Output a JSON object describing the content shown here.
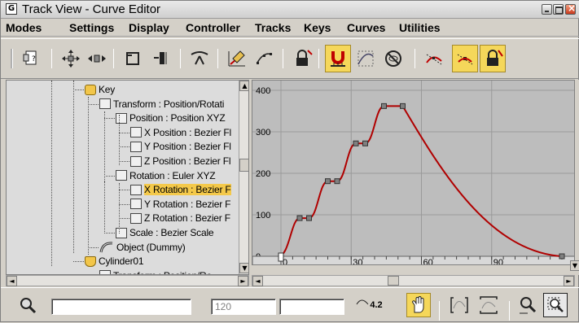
{
  "window": {
    "title": "Track View - Curve Editor",
    "app_icon": "curve-editor-icon"
  },
  "menu": [
    "Modes",
    "Settings",
    "Display",
    "Controller",
    "Tracks",
    "Keys",
    "Curves",
    "Utilities"
  ],
  "toolbar": [
    {
      "name": "filters-icon",
      "active": false
    },
    {
      "name": "move-keys-icon",
      "active": false
    },
    {
      "name": "slide-keys-icon",
      "active": false
    },
    {
      "name": "scale-keys-icon",
      "active": false
    },
    {
      "name": "scale-values-icon",
      "active": false
    },
    {
      "name": "add-keys-icon",
      "active": false
    },
    {
      "name": "draw-curves-icon",
      "active": false
    },
    {
      "name": "reduce-keys-icon",
      "active": false
    },
    {
      "name": "lock-selection-icon",
      "active": false
    },
    {
      "name": "snap-frames-icon",
      "active": true
    },
    {
      "name": "parameter-curve-out-of-range-icon",
      "active": false
    },
    {
      "name": "show-keyable-icon",
      "active": false
    },
    {
      "name": "tangents-icon",
      "active": false
    },
    {
      "name": "show-tangents-icon",
      "active": true
    },
    {
      "name": "lock-tangents-icon",
      "active": true
    }
  ],
  "tree": [
    {
      "label": "Key",
      "icon": "key",
      "level": 0,
      "selected": false
    },
    {
      "label": "Transform : Position/Rotati",
      "icon": "transform",
      "level": 1,
      "selected": false
    },
    {
      "label": "Position : Position XYZ",
      "icon": "position",
      "level": 2,
      "selected": false
    },
    {
      "label": "X Position : Bezier Fl",
      "icon": "curve",
      "level": 3,
      "selected": false
    },
    {
      "label": "Y Position : Bezier Fl",
      "icon": "curve",
      "level": 3,
      "selected": false
    },
    {
      "label": "Z Position : Bezier Fl",
      "icon": "curve",
      "level": 3,
      "selected": false
    },
    {
      "label": "Rotation : Euler XYZ",
      "icon": "rotation",
      "level": 2,
      "selected": false
    },
    {
      "label": "X Rotation : Bezier F",
      "icon": "curve",
      "level": 3,
      "selected": true
    },
    {
      "label": "Y Rotation : Bezier F",
      "icon": "curve",
      "level": 3,
      "selected": false
    },
    {
      "label": "Z Rotation : Bezier F",
      "icon": "curve",
      "level": 3,
      "selected": false
    },
    {
      "label": "Scale : Bezier Scale",
      "icon": "scale",
      "level": 2,
      "selected": false
    },
    {
      "label": "Object (Dummy)",
      "icon": "object",
      "level": 1,
      "selected": false
    },
    {
      "label": "Cylinder01",
      "icon": "cylinder",
      "level": 0,
      "selected": false
    },
    {
      "label": "Transform : Position/Ro",
      "icon": "transform",
      "level": 1,
      "selected": false
    }
  ],
  "chart_data": {
    "type": "line",
    "x_ticks": [
      "0",
      "30",
      "60",
      "90"
    ],
    "y_ticks": [
      "0",
      "100",
      "200",
      "300",
      "400"
    ],
    "xlim": [
      -8,
      120
    ],
    "ylim": [
      -5,
      400
    ],
    "grid": true,
    "series": [
      {
        "keys": [
          [
            0,
            0
          ],
          [
            8,
            92
          ],
          [
            12,
            92
          ],
          [
            20,
            181
          ],
          [
            24,
            181
          ],
          [
            32,
            272
          ],
          [
            36,
            272
          ],
          [
            44,
            362
          ],
          [
            52,
            362
          ],
          [
            120,
            0
          ]
        ]
      }
    ],
    "curve_color": "#b00000",
    "key_color": "#808080"
  },
  "status": {
    "field_time": "120",
    "zoom_value": "4.2",
    "icons": [
      "isolate-curve-icon",
      "pan-icon",
      "zoom-horizontal-extents-icon",
      "zoom-value-extents-icon",
      "zoom-icon",
      "zoom-region-icon"
    ]
  }
}
